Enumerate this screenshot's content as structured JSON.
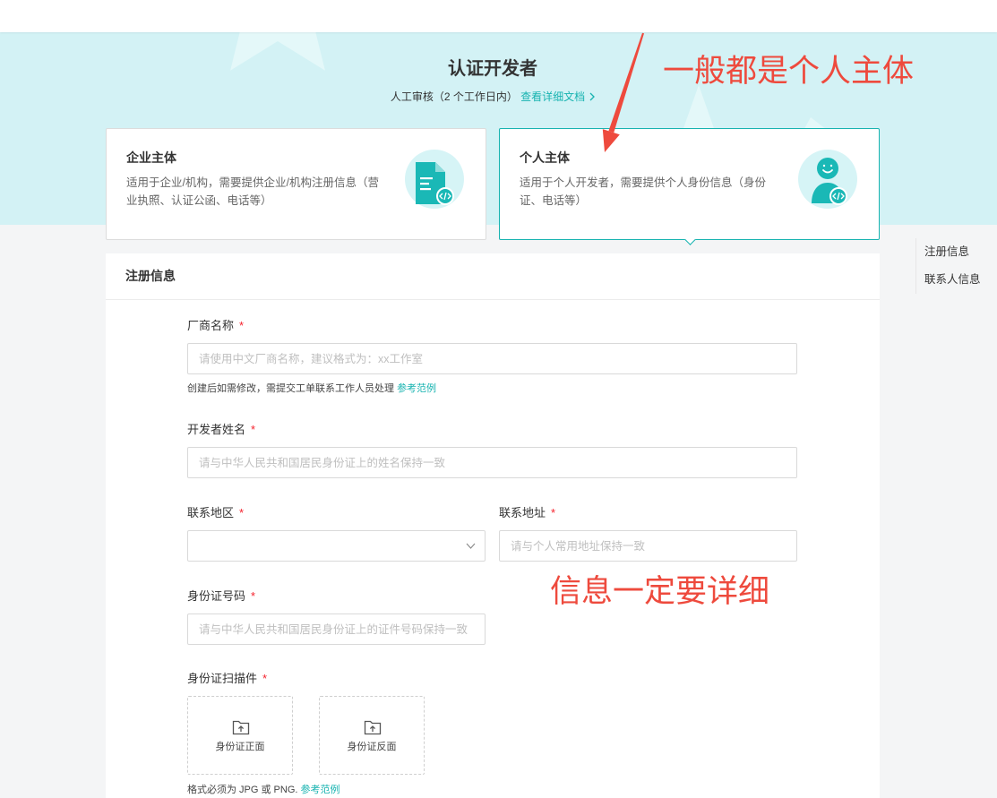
{
  "banner": {
    "title": "认证开发者",
    "review_note": "人工审核（2 个工作日内）",
    "doc_link": "查看详细文档"
  },
  "entity_cards": [
    {
      "title": "企业主体",
      "desc_lines": [
        "适用于企业/机构，需要提供企业/机构注册信息（营",
        "业执照、认证公函、电话等）"
      ],
      "icon": "enterprise-document-icon",
      "selected": false
    },
    {
      "title": "个人主体",
      "desc_lines": [
        "适用于个人开发者，需要提供个人身份信息（身份",
        "证、电话等）"
      ],
      "icon": "personal-user-icon",
      "selected": true
    }
  ],
  "annotations": {
    "entity_tip": "一般都是个人主体",
    "info_tip": "信息一定要详细"
  },
  "side_nav": {
    "items": [
      "注册信息",
      "联系人信息"
    ]
  },
  "form": {
    "section_title": "注册信息",
    "required_mark": "*",
    "vendor_name": {
      "label": "厂商名称",
      "placeholder": "请使用中文厂商名称，建议格式为：xx工作室",
      "hint": "创建后如需修改，需提交工单联系工作人员处理",
      "hint_link": "参考范例"
    },
    "developer_name": {
      "label": "开发者姓名",
      "placeholder": "请与中华人民共和国居民身份证上的姓名保持一致"
    },
    "contact_region": {
      "label": "联系地区"
    },
    "contact_address": {
      "label": "联系地址",
      "placeholder": "请与个人常用地址保持一致"
    },
    "id_number": {
      "label": "身份证号码",
      "placeholder": "请与中华人民共和国居民身份证上的证件号码保持一致"
    },
    "id_scan": {
      "label": "身份证扫描件",
      "front": "身份证正面",
      "back": "身份证反面",
      "format_note": "格式必须为 JPG 或 PNG.",
      "format_link": "参考范例"
    }
  },
  "colors": {
    "accent": "#17b3b0",
    "banner": "#d3f2f5",
    "annotation": "#ee4a3d",
    "required": "#f5222d"
  }
}
